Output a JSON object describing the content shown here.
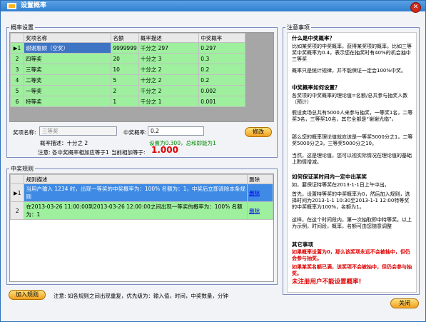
{
  "window": {
    "title": "设置概率"
  },
  "prize_section": {
    "legend": "概率设置",
    "columns": [
      "奖项名称",
      "名额",
      "概率描述",
      "中奖概率"
    ],
    "rows": [
      {
        "idx": "1",
        "name": "谢谢惠顾（空奖）",
        "count": "9999999",
        "desc": "千分之 297",
        "prob": "0.297"
      },
      {
        "idx": "2",
        "name": "四等奖",
        "count": "20",
        "desc": "十分之 3",
        "prob": "0.3"
      },
      {
        "idx": "3",
        "name": "三等奖",
        "count": "10",
        "desc": "十分之 2",
        "prob": "0.2"
      },
      {
        "idx": "4",
        "name": "二等奖",
        "count": "5",
        "desc": "十分之 2",
        "prob": "0.2"
      },
      {
        "idx": "5",
        "name": "一等奖",
        "count": "2",
        "desc": "千分之 2",
        "prob": "0.002"
      },
      {
        "idx": "6",
        "name": "特等奖",
        "count": "1",
        "desc": "千分之 1",
        "prob": "0.001"
      }
    ],
    "name_label": "奖项名称:",
    "name_value": "三等奖",
    "prob_label": "中奖概率:",
    "prob_value": "0.2",
    "desc_label": "概率描述：",
    "desc_value": "十分之 2",
    "green_note": "设置为0.300，总和即能为1",
    "sum_note": "注意: 各中奖概率相加应等于1",
    "sum_label": "当前相加等于:",
    "sum_value": "1.000",
    "modify_btn": "修改"
  },
  "rules_section": {
    "legend": "中奖规则",
    "columns": [
      "规则描述",
      "删除"
    ],
    "rows": [
      {
        "idx": "1",
        "desc": "当用户输入 1234 时，出现一等奖的中奖概率为：100%  名额为：1，中奖后立即清除本条规则",
        "del": "删除"
      },
      {
        "idx": "2",
        "desc": "在2013-03-26 11:00:00到2013-03-26 12:00:00之间出现一等奖的概率为：100%  名额为：1",
        "del": "删除"
      }
    ],
    "add_btn": "加入规则",
    "footer_note": "注意: 如各规则之间出现重复，优先级为：输入值，时间，中奖数量，分钟"
  },
  "notes": {
    "legend": "注意事项",
    "h1": "什么是中奖概率？",
    "p1": "比如某奖项的中奖概率，获得某奖项的概率。比如三等奖中奖概率为0.4，表示您在抽奖时有40%的机会抽中三等奖",
    "p2": "概率只是统计规律，并不能保证一定会100%中奖。",
    "h2": "中奖概率如何设置？",
    "p3": "各奖项的中奖概率的理论值=名额/总共参与抽奖人数（预计）",
    "p4": "假设卖场总共有5000人来参与抽奖，一等奖1名，二等奖3名，三等奖10名，其它全部是“谢谢光临”。",
    "p5": "那么您的概率理论值就应该是一等奖5000分之1，二等奖5000分之3，三等奖5000分之10。",
    "p6": "当然，这是理论值，您可以视实际情况在理论值的基础上酌情增减。",
    "h3": "如何保证某时间内一定中出某奖",
    "p7": "如，要保证特等奖在2013-1-1日上午中出。",
    "p8": "首先，设置特等奖的中奖概率为0，然后加入规则，选择时间为2013-1-1 10:30至2013-1-1 12:00特等奖的中奖概率为100%，名额为1。",
    "p9": "这样，在这个时间段内，第一次抽取即中特等奖。以上为示例，时间段，概率，名额可由您随意调整",
    "h4": "其它事项",
    "r1": "如果概率设置为0，那么该奖项永远不会被抽中，但仍会参与抽奖。",
    "r2": "如果某奖名额已满，该奖项不会被抽中，但仍会参与抽奖。",
    "r3": "未注册用户不能设置概率!",
    "close_btn": "关闭"
  }
}
